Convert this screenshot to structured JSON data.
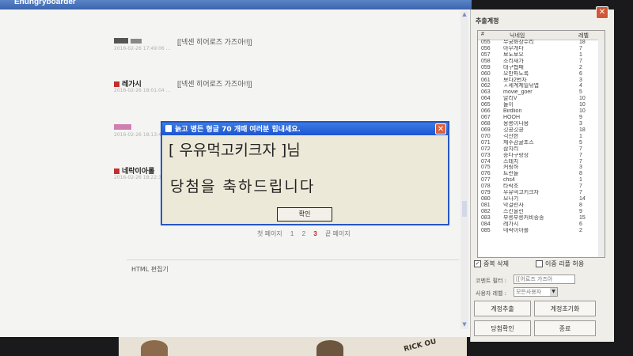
{
  "main_window": {
    "title": "Ehungryboarder",
    "posts": [
      {
        "nick": "",
        "meta": "2016-02-26 17:49:06\n...",
        "comment": "[[넥센 히어로즈 가즈아!!]]"
      },
      {
        "nick": "레가시",
        "meta": "2016-02-26 18:01:04\n...",
        "comment": "[[넥센 히어로즈 가즈아!!]]"
      },
      {
        "nick": "",
        "meta": "2016-02-26 18:13:46\n...",
        "comment": ""
      },
      {
        "nick": "네락이아롤",
        "meta": "2016-02-26 18:22:36\n...",
        "comment": ""
      }
    ],
    "pager": {
      "first": "첫 페이지",
      "pages": [
        "1",
        "2",
        "3"
      ],
      "current": "3",
      "last": "끝 페이지"
    },
    "html_editor_label": "HTML 편집기"
  },
  "side_panel": {
    "title": "추출계정",
    "close_label": "✕",
    "columns": {
      "num": "#",
      "nick": "닉네임",
      "level": "레벨"
    },
    "rows": [
      [
        "055",
        "무궁화장수리",
        "18"
      ],
      [
        "056",
        "아무개다",
        "7"
      ],
      [
        "057",
        "보노보오",
        "1"
      ],
      [
        "058",
        "소리새가",
        "7"
      ],
      [
        "059",
        "대구협패",
        "2"
      ],
      [
        "060",
        "오만파도록",
        "6"
      ],
      [
        "061",
        "보다2번차",
        "3"
      ],
      [
        "062",
        "ㅅ세계제일낚엽",
        "4"
      ],
      [
        "063",
        "movie_goer",
        "5"
      ],
      [
        "064",
        "알리V",
        "10"
      ],
      [
        "065",
        "놀이",
        "10"
      ],
      [
        "066",
        "Birdlion",
        "10"
      ],
      [
        "067",
        "HOOH",
        "9"
      ],
      [
        "068",
        "몽롱이나용",
        "3"
      ],
      [
        "069",
        "깃콩깃콩",
        "18"
      ],
      [
        "070",
        "긱잔한",
        "1"
      ],
      [
        "071",
        "제주감귤초스",
        "5"
      ],
      [
        "072",
        "삼치리",
        "7"
      ],
      [
        "073",
        "승다구랑장",
        "7"
      ],
      [
        "074",
        "스테치",
        "7"
      ],
      [
        "075",
        "커링하",
        "3"
      ],
      [
        "076",
        "트런들",
        "8"
      ],
      [
        "077",
        "chs4",
        "1"
      ],
      [
        "078",
        "타락조",
        "7"
      ],
      [
        "079",
        "우유먹고키크자",
        "7"
      ],
      [
        "080",
        "모나기",
        "14"
      ],
      [
        "081",
        "막걸련사",
        "8"
      ],
      [
        "082",
        "스킨울린",
        "9"
      ],
      [
        "083",
        "부릉부릉커비송송",
        "15"
      ],
      [
        "084",
        "레가시",
        "6"
      ],
      [
        "085",
        "네락이아롤",
        "2"
      ]
    ],
    "dedupe_label": "중복 삭제",
    "dedupe_checked": "✓",
    "same_level_label": "이중 리플 허용",
    "filter_label": "코멘트 필터 :",
    "filter_value": "[[어로즈 가즈아",
    "level_label": "사용자 레벨 :",
    "level_value": "모든사용자",
    "extract_button": "계정추출",
    "reset_button": "계정초기화",
    "confirm_button": "당첨확인",
    "exit_button": "종료"
  },
  "dialog": {
    "title": "늙고 병든 형글 70 개때 여러분 힘내세요.",
    "winner_line": "[ 우유먹고키크자 ]님",
    "congrats_line": "당첨을 축하드립니다",
    "ok_button": "확인",
    "close_label": "✕"
  },
  "sticker_text": "RICK OU"
}
